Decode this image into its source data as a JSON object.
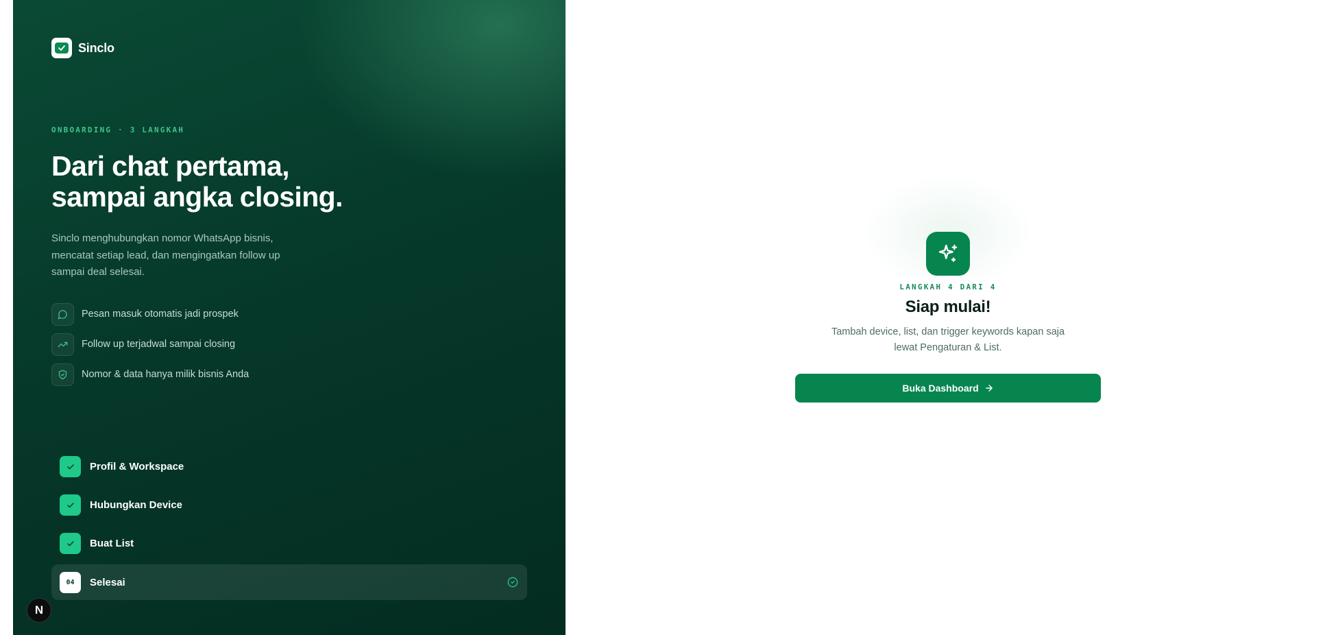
{
  "brand": {
    "name": "Sinclo",
    "logo_icon": "chat-check-icon"
  },
  "intro": {
    "eyebrow": "ONBOARDING · 3 LANGKAH",
    "headline_line1": "Dari chat pertama,",
    "headline_line2": "sampai angka closing.",
    "description": "Sinclo menghubungkan nomor WhatsApp bisnis, mencatat setiap lead, dan mengingatkan follow up sampai deal selesai."
  },
  "features": [
    {
      "icon": "message-circle-icon",
      "label": "Pesan masuk otomatis jadi prospek"
    },
    {
      "icon": "trending-up-icon",
      "label": "Follow up terjadwal sampai closing"
    },
    {
      "icon": "shield-check-icon",
      "label": "Nomor & data hanya milik bisnis Anda"
    }
  ],
  "steps": [
    {
      "label": "Profil & Workspace",
      "status": "done"
    },
    {
      "label": "Hubungkan Device",
      "status": "done"
    },
    {
      "label": "Buat List",
      "status": "done"
    },
    {
      "label": "Selesai",
      "status": "active",
      "number": "04"
    }
  ],
  "final_step": {
    "icon": "sparkles-icon",
    "counter": "LANGKAH 4 DARI 4",
    "title": "Siap mulai!",
    "description": "Tambah device, list, dan trigger keywords kapan saja lewat Pengaturan & List.",
    "button_label": "Buka Dashboard"
  },
  "dev_badge": {
    "label": "N"
  },
  "colors": {
    "accent": "#07854f",
    "accent_bright": "#1ec98a",
    "panel_dark": "#06392a",
    "eyebrow": "#3fc48a"
  }
}
